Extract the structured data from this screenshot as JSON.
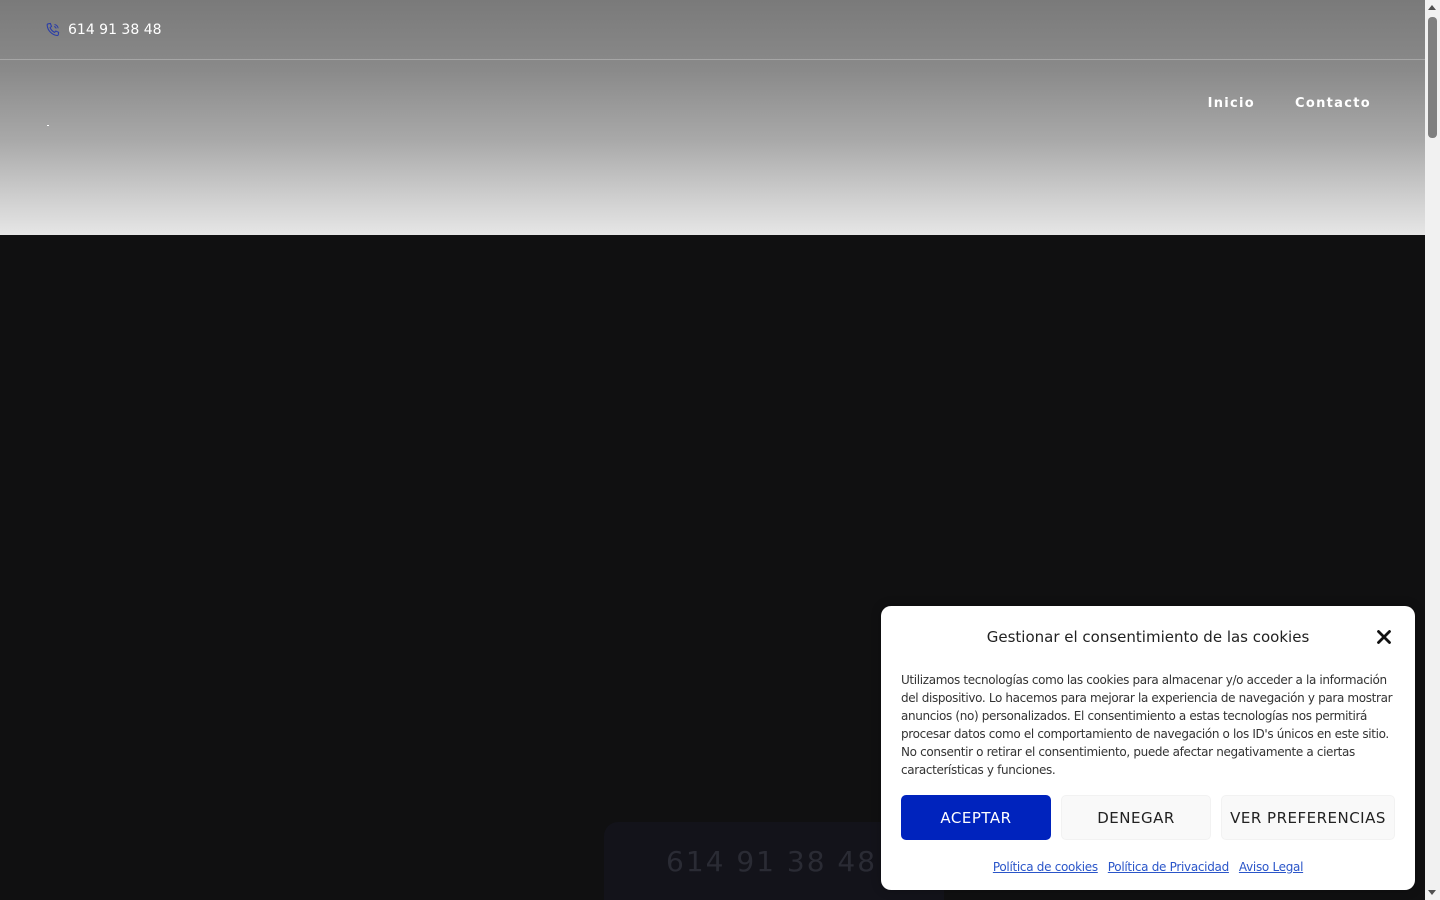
{
  "topbar": {
    "phone": "614 91 38 48",
    "phone_icon": "phone-icon"
  },
  "nav": {
    "items": [
      {
        "label": "Inicio"
      },
      {
        "label": "Contacto"
      }
    ]
  },
  "floating_phone": {
    "number": "614 91 38 48",
    "chevron": "❯"
  },
  "cookie": {
    "title": "Gestionar el consentimiento de las cookies",
    "body": "Utilizamos tecnologías como las cookies para almacenar y/o acceder a la información del dispositivo. Lo hacemos para mejorar la experiencia de navegación y para mostrar anuncios (no) personalizados. El consentimiento a estas tecnologías nos permitirá procesar datos como el comportamiento de navegación o los ID's únicos en este sitio. No consentir o retirar el consentimiento, puede afectar negativamente a ciertas características y funciones.",
    "accept_label": "ACEPTAR",
    "deny_label": "DENEGAR",
    "prefs_label": "VER PREFERENCIAS",
    "links": [
      {
        "label": "Política de cookies"
      },
      {
        "label": "Política de Privacidad"
      },
      {
        "label": "Aviso Legal"
      }
    ],
    "close_icon": "close-icon"
  },
  "colors": {
    "accent": "#0023bd",
    "background": "#101011",
    "link": "#2a55c9"
  }
}
